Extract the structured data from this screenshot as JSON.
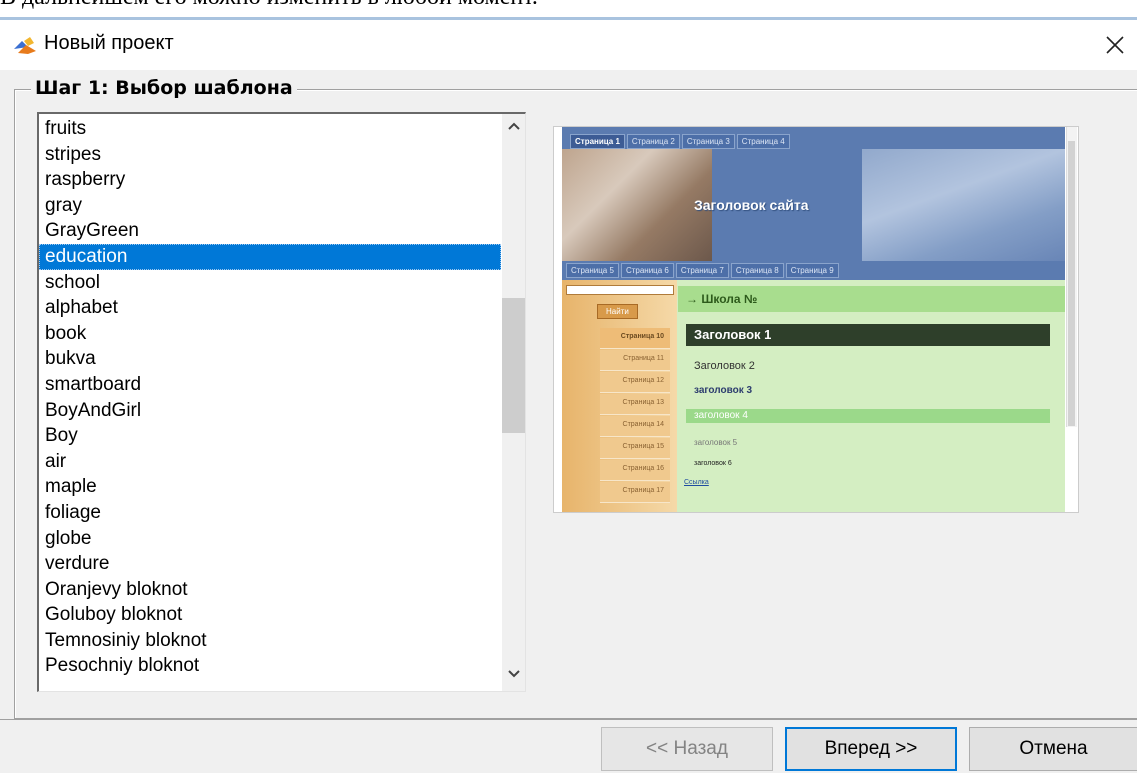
{
  "document_strip": {
    "text": "В дальнейшем его можно изменить в любой момент."
  },
  "window": {
    "title": "Новый проект",
    "close_glyph": "×"
  },
  "group": {
    "title": "Шаг 1: Выбор шаблона"
  },
  "template_list": {
    "items": [
      {
        "label": "fruits"
      },
      {
        "label": "stripes"
      },
      {
        "label": "raspberry"
      },
      {
        "label": "gray"
      },
      {
        "label": "GrayGreen"
      },
      {
        "label": "education",
        "selected": true
      },
      {
        "label": "school"
      },
      {
        "label": "alphabet"
      },
      {
        "label": "book"
      },
      {
        "label": "bukva"
      },
      {
        "label": "smartboard"
      },
      {
        "label": "BoyAndGirl"
      },
      {
        "label": "Boy"
      },
      {
        "label": "air"
      },
      {
        "label": "maple"
      },
      {
        "label": "foliage"
      },
      {
        "label": "globe"
      },
      {
        "label": "verdure"
      },
      {
        "label": "Oranjevy bloknot"
      },
      {
        "label": "Goluboy bloknot"
      },
      {
        "label": "Temnosiniy bloknot"
      },
      {
        "label": "Pesochniy bloknot"
      }
    ]
  },
  "preview": {
    "tabs_top": [
      "Страница 1",
      "Страница 2",
      "Страница 3",
      "Страница 4"
    ],
    "site_title": "Заголовок сайта",
    "tabs_bottom": [
      "Страница 5",
      "Страница 6",
      "Страница 7",
      "Страница 8",
      "Страница 9"
    ],
    "find_button": "Найти",
    "menu": [
      "Страница 10",
      "Страница 11",
      "Страница 12",
      "Страница 13",
      "Страница 14",
      "Страница 15",
      "Страница 16",
      "Страница 17"
    ],
    "school_heading": "→ Школа №",
    "heading1": "Заголовок 1",
    "heading2": "Заголовок 2",
    "heading3": "заголовок 3",
    "heading4": "заголовок 4",
    "heading5": "заголовок 5",
    "heading6": "заголовок 6",
    "link": "Ссылка"
  },
  "buttons": {
    "back": "<< Назад",
    "next": "Вперед >>",
    "cancel": "Отмена"
  },
  "colors": {
    "selection": "#0078d7",
    "window_bg": "#f0f0f0"
  }
}
